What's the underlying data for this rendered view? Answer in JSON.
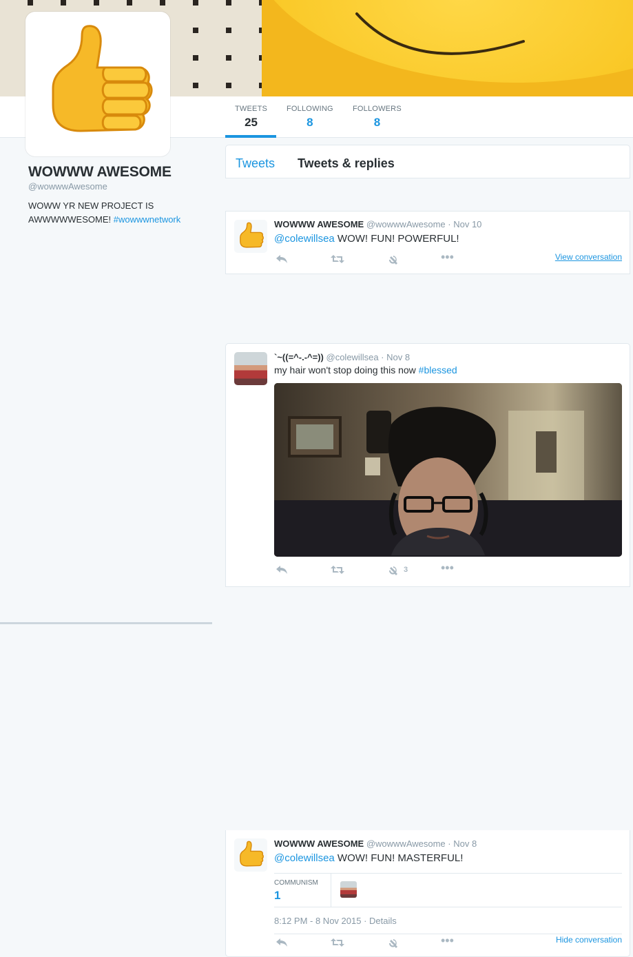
{
  "profile": {
    "name": "WOWWW AWESOME",
    "handle": "@wowwwAwesome",
    "bio_text": "WOWW YR NEW PROJECT IS AWWWWWESOME!",
    "bio_hashtag": "#wowwwnetwork"
  },
  "stats": [
    {
      "label": "TWEETS",
      "value": "25"
    },
    {
      "label": "FOLLOWING",
      "value": "8"
    },
    {
      "label": "FOLLOWERS",
      "value": "8"
    }
  ],
  "tabs": {
    "tweets": "Tweets",
    "replies": "Tweets & replies"
  },
  "tweets": [
    {
      "name": "WOWWW AWESOME",
      "meta": "@wowwwAwesome · Nov 10",
      "mention": "@colewillsea",
      "text": " WOW! FUN! POWERFUL!",
      "link": "View conversation"
    },
    {
      "name": "`~((=^-.-^=))",
      "meta": "@colewillsea · Nov 8",
      "text": "my hair won't stop doing this now ",
      "hashtag": "#blessed",
      "like_count": "3"
    },
    {
      "name": "WOWWW AWESOME",
      "meta": "@wowwwAwesome · Nov 8",
      "mention": "@colewillsea",
      "text": " WOW! FUN! MASTERFUL!",
      "stat_label": "COMMUNISM",
      "stat_value": "1",
      "timestamp": "8:12 PM - 8 Nov 2015",
      "details": " · Details",
      "link": "Hide conversation"
    }
  ]
}
